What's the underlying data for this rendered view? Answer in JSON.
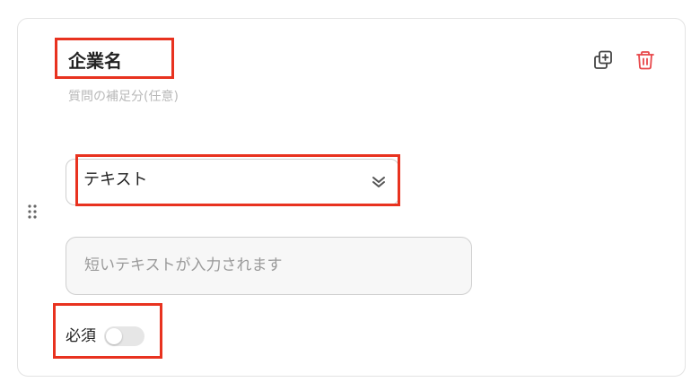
{
  "question": {
    "title": "企業名",
    "subtitle": "質問の補足分(任意)"
  },
  "answer_type": {
    "selected": "テキスト"
  },
  "answer": {
    "placeholder": "短いテキストが入力されます"
  },
  "required": {
    "label": "必須",
    "enabled": false
  },
  "icons": {
    "copy": "duplicate-icon",
    "delete": "trash-icon",
    "drag": "drag-handle-icon",
    "chevron": "chevron-double-down-icon"
  },
  "colors": {
    "highlight": "#e8321f",
    "delete_icon": "#e8474a",
    "toggle_off": "#e6e6e6"
  }
}
